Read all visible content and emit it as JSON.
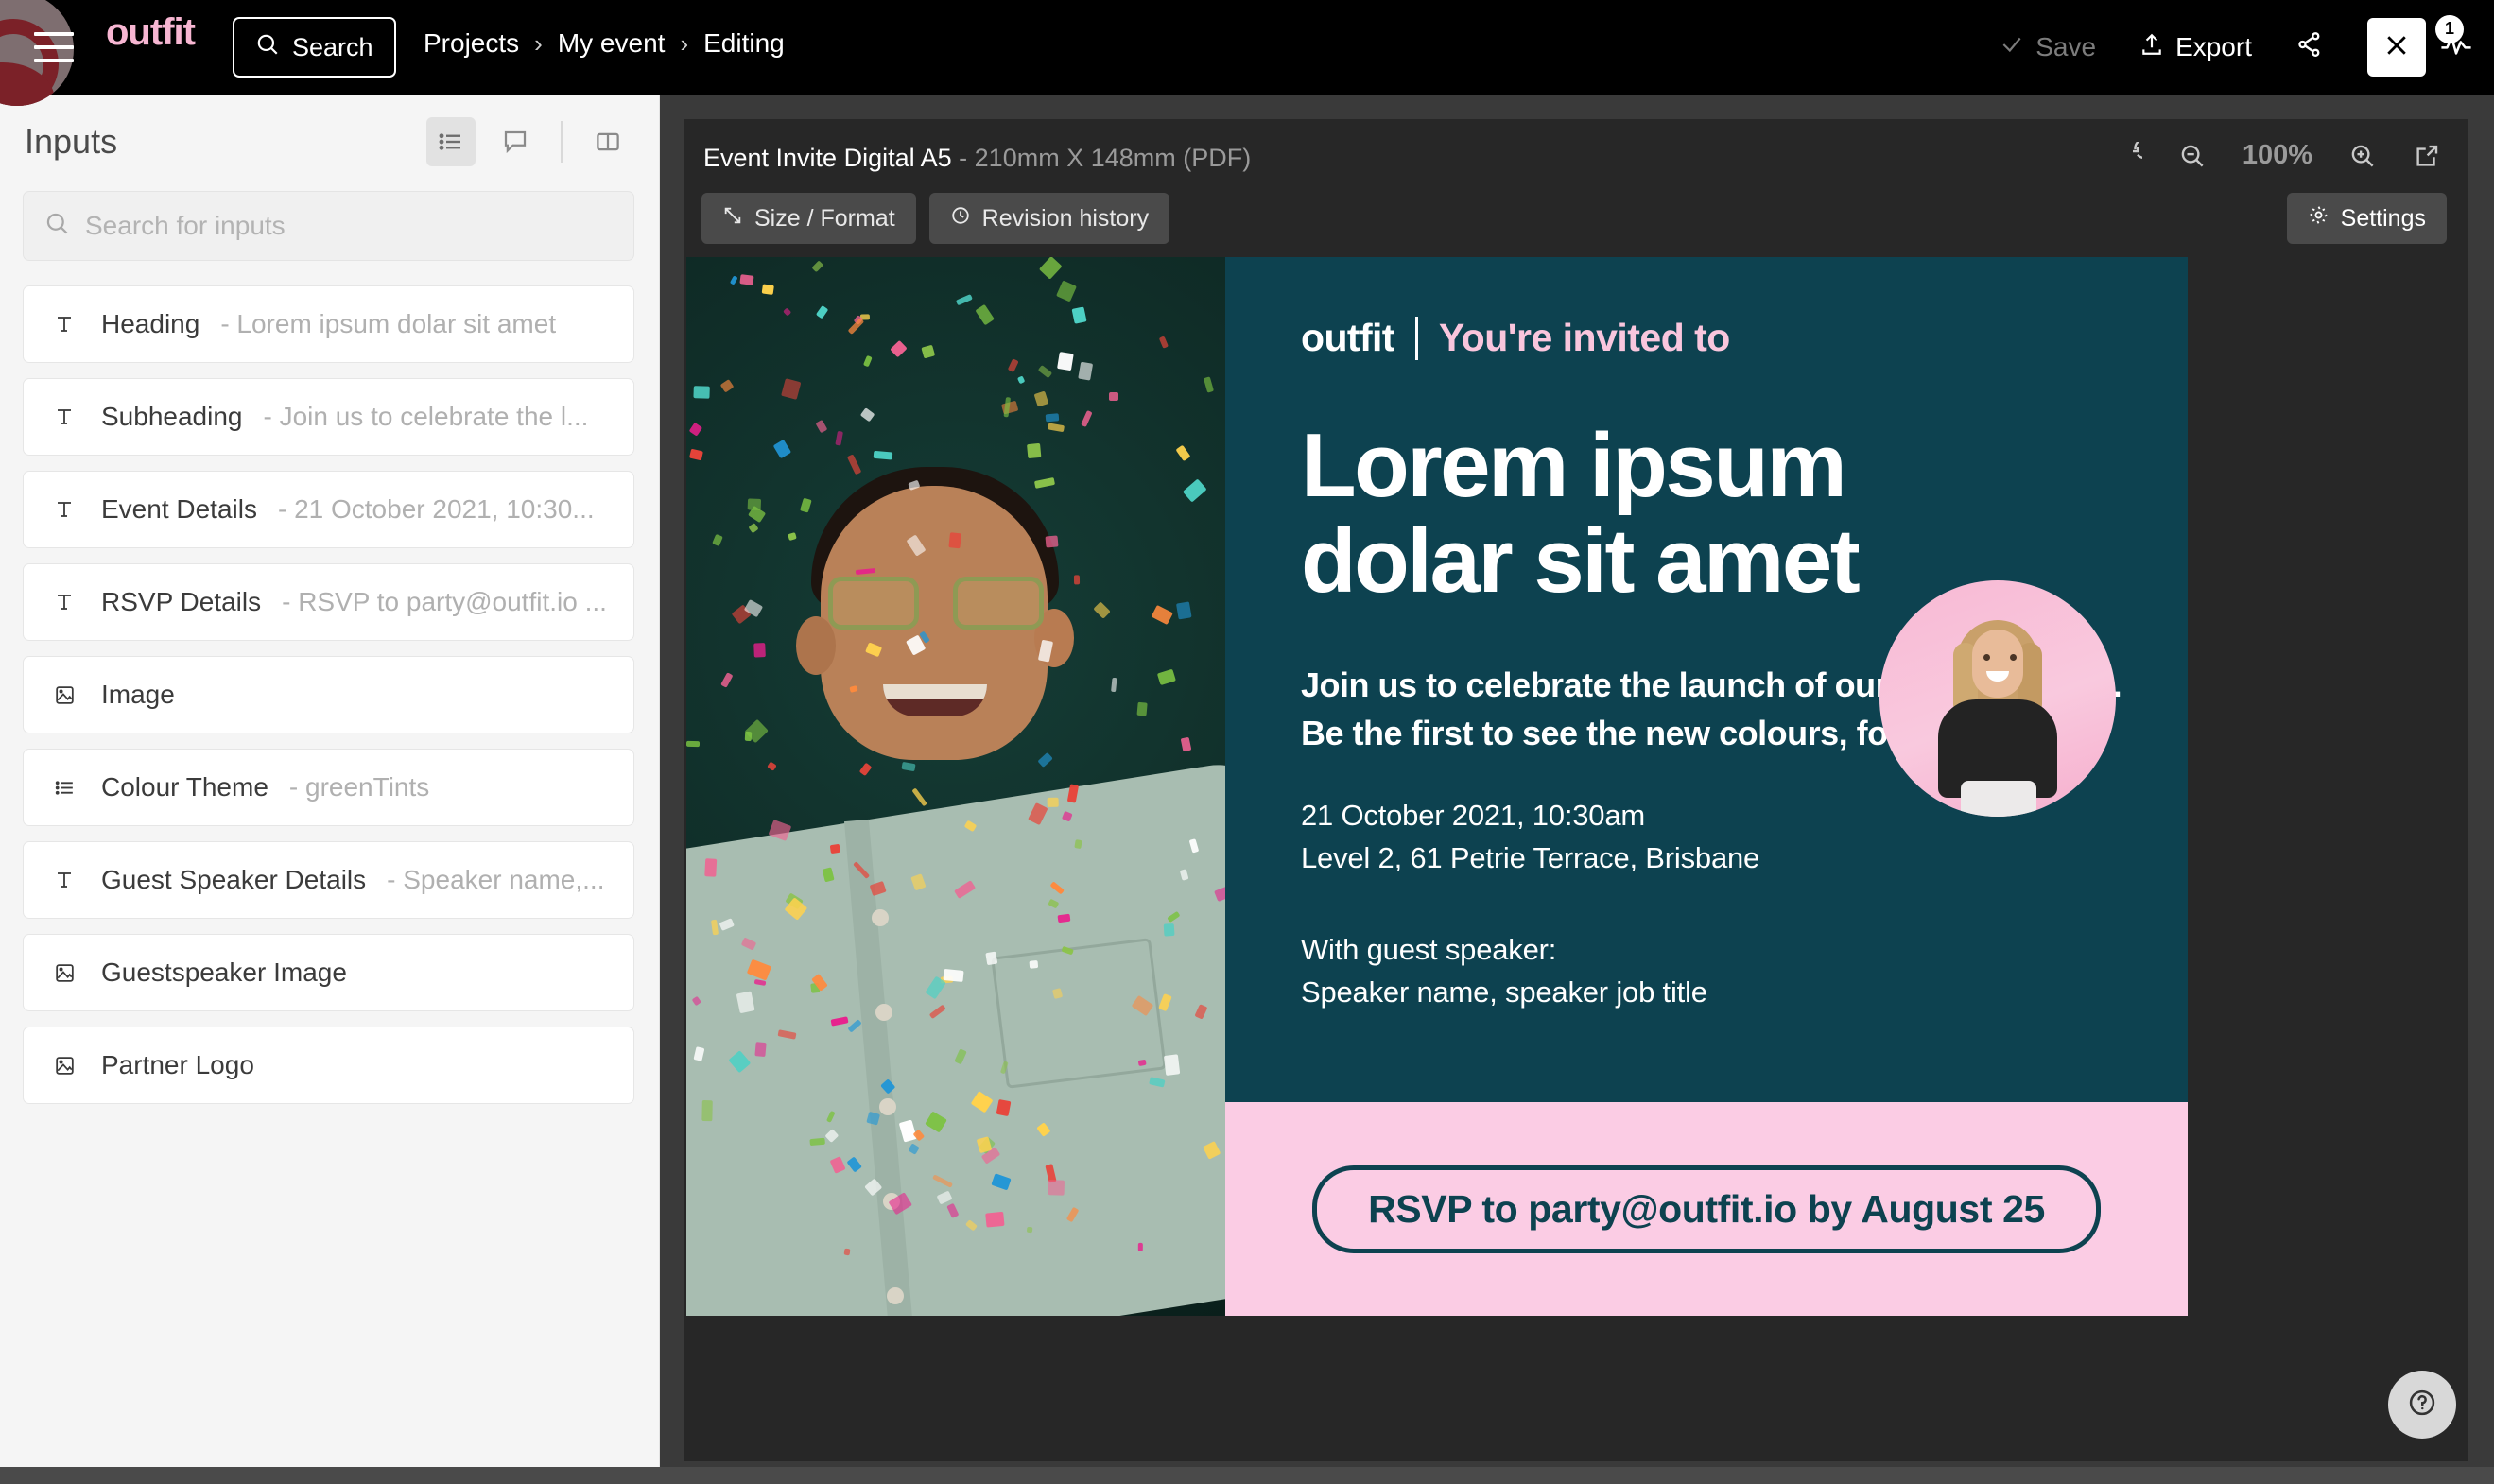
{
  "topbar": {
    "brand": "outfit",
    "search_label": "Search",
    "breadcrumb": [
      "Projects",
      "My event",
      "Editing"
    ],
    "separator": "›",
    "save_label": "Save",
    "export_label": "Export",
    "notification_count": "1"
  },
  "sidebar": {
    "title": "Inputs",
    "search_placeholder": "Search for inputs",
    "view_icons": [
      "list-view-icon",
      "comment-icon",
      "split-panel-icon"
    ],
    "items": [
      {
        "icon": "text-icon",
        "label": "Heading",
        "value": "- Lorem ipsum dolar sit amet"
      },
      {
        "icon": "text-icon",
        "label": "Subheading",
        "value": "- Join us to celebrate the l..."
      },
      {
        "icon": "text-icon",
        "label": "Event Details",
        "value": "- 21 October 2021, 10:30..."
      },
      {
        "icon": "text-icon",
        "label": "RSVP Details",
        "value": "- RSVP to party@outfit.io ..."
      },
      {
        "icon": "image-icon",
        "label": "Image",
        "value": ""
      },
      {
        "icon": "list-icon",
        "label": "Colour Theme",
        "value": "- greenTints"
      },
      {
        "icon": "text-icon",
        "label": "Guest Speaker Details",
        "value": "- Speaker name,..."
      },
      {
        "icon": "image-icon",
        "label": "Guestspeaker Image",
        "value": ""
      },
      {
        "icon": "image-icon",
        "label": "Partner Logo",
        "value": ""
      }
    ]
  },
  "canvas": {
    "doc_name": "Event Invite Digital A5",
    "doc_dimensions": "- 210mm X 148mm (PDF)",
    "size_format_label": "Size / Format",
    "revision_history_label": "Revision history",
    "settings_label": "Settings",
    "zoom_value": "100%",
    "help_label": "?"
  },
  "invite": {
    "logo": "outfit",
    "invited_text": "You're invited to",
    "heading_line1": "Lorem ipsum",
    "heading_line2": "dolar sit amet",
    "sub_line1": "Join us to celebrate the launch of our new branding.",
    "sub_line2": "Be the first to see the new colours, font, and logo.",
    "when_line1": "21 October 2021, 10:30am",
    "when_line2": "Level 2, 61 Petrie Terrace, Brisbane",
    "speaker_line1": "With guest speaker:",
    "speaker_line2": "Speaker name, speaker job title",
    "rsvp_text": "RSVP to party@outfit.io by August 25"
  },
  "colors": {
    "teal": "#0d4250",
    "pink": "#fbcce4",
    "brand_pink": "#f7b6d2",
    "panel_dark": "#272727",
    "workspace": "#3a3a3a"
  }
}
